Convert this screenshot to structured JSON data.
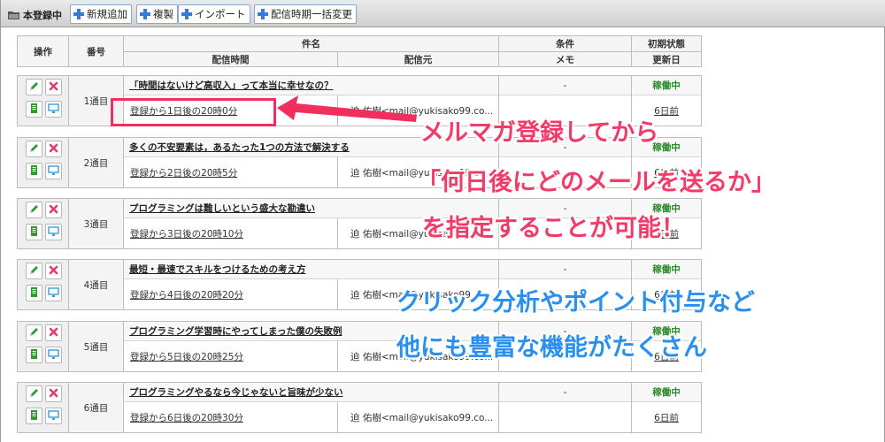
{
  "toolbar": {
    "title": "本登録中",
    "buttons": [
      "新規追加",
      "複製",
      "インポート",
      "配信時期一括変更"
    ]
  },
  "header": {
    "ops": "操作",
    "num": "番号",
    "subject": "件名",
    "time": "配信時間",
    "from": "配信元",
    "condition": "条件",
    "memo": "メモ",
    "initial_state": "初期状態",
    "updated": "更新日"
  },
  "rows": [
    {
      "num": "1通目",
      "subject": "「時間はないけど高収入」って本当に幸せなの？",
      "memo": "-",
      "state": "稼働中",
      "time": "登録から1日後の20時0分",
      "from": "迫 佑樹<mail@yukisako99.co...",
      "updated": "6日前"
    },
    {
      "num": "2通目",
      "subject": "多くの不安要素は，あるたった1つの方法で解決する",
      "memo": "-",
      "state": "稼働中",
      "time": "登録から2日後の20時5分",
      "from": "迫 佑樹<mail@yukisako99.co...",
      "updated": "6日前"
    },
    {
      "num": "3通目",
      "subject": "プログラミングは難しいという盛大な勘違い",
      "memo": "-",
      "state": "稼働中",
      "time": "登録から3日後の20時10分",
      "from": "迫 佑樹<mail@yukisako99.co...",
      "updated": "6日前"
    },
    {
      "num": "4通目",
      "subject": "最短・最速でスキルをつけるための考え方",
      "memo": "-",
      "state": "稼働中",
      "time": "登録から4日後の20時20分",
      "from": "迫 佑樹<mail@yukisako99.co...",
      "updated": "6日前"
    },
    {
      "num": "5通目",
      "subject": "プログラミング学習時にやってしまった僕の失敗例",
      "memo": "-",
      "state": "稼働中",
      "time": "登録から5日後の20時25分",
      "from": "迫 佑樹<mail@yukisako99.co...",
      "updated": "6日前"
    },
    {
      "num": "6通目",
      "subject": "プログラミングやるなら今じゃないと旨味が少ない",
      "memo": "-",
      "state": "稼働中",
      "time": "登録から6日後の20時30分",
      "from": "迫 佑樹<mail@yukisako99.co...",
      "updated": "6日前"
    }
  ],
  "callouts": {
    "pink": [
      "メルマガ登録してから",
      "「何日後にどのメールを送るか」",
      "を指定することが可能！"
    ],
    "blue": [
      "クリック分析やポイント付与など",
      "他にも豊富な機能がたくさん"
    ]
  },
  "colors": {
    "accent_pink": "#f12f5d",
    "callout_blue": "#2b8ff0",
    "active_green": "#2e8b2e",
    "toolbar_button_border": "#8aa6d6"
  },
  "icons": {
    "edit": "pencil-icon",
    "delete": "x-icon",
    "copy": "document-icon",
    "preview": "monitor-icon",
    "add": "plus-icon",
    "folder": "folder-icon"
  }
}
